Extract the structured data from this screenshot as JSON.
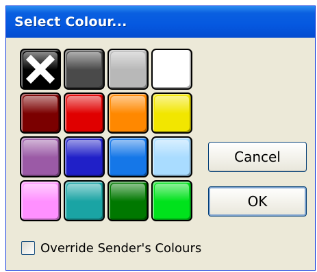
{
  "window": {
    "title": "Select Colour..."
  },
  "palette": {
    "swatches": [
      {
        "name": "none",
        "color": "#000000"
      },
      {
        "name": "dark-gray",
        "color": "#4a4a4a"
      },
      {
        "name": "light-gray",
        "color": "#b8b8b8"
      },
      {
        "name": "white",
        "color": "#ffffff"
      },
      {
        "name": "maroon",
        "color": "#7b0000"
      },
      {
        "name": "red",
        "color": "#e00000"
      },
      {
        "name": "orange",
        "color": "#ff8800"
      },
      {
        "name": "yellow",
        "color": "#f2e600"
      },
      {
        "name": "purple",
        "color": "#9b5aa6"
      },
      {
        "name": "blue",
        "color": "#2020c8"
      },
      {
        "name": "sky-blue",
        "color": "#1577e8"
      },
      {
        "name": "light-blue",
        "color": "#a9dcff"
      },
      {
        "name": "pink",
        "color": "#ff90ff"
      },
      {
        "name": "teal",
        "color": "#1aa4a4"
      },
      {
        "name": "dark-green",
        "color": "#007800"
      },
      {
        "name": "green",
        "color": "#00e21c"
      }
    ]
  },
  "buttons": {
    "cancel_label": "Cancel",
    "ok_label": "OK"
  },
  "override": {
    "label": "Override Sender's Colours",
    "checked": false
  }
}
